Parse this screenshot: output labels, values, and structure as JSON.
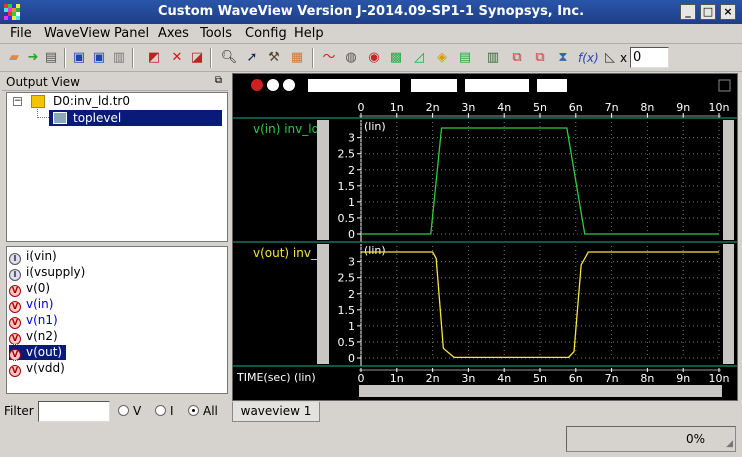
{
  "window": {
    "title": "Custom WaveView Version J-2014.09-SP1-1 Synopsys, Inc."
  },
  "menu": [
    "File",
    "WaveView",
    "Panel",
    "Axes",
    "Tools",
    "Config",
    "Help"
  ],
  "toolbar": {
    "x_label": "x",
    "x_value": "0"
  },
  "output_view": {
    "title": "Output View",
    "tree_root": "D0:inv_ld.tr0",
    "tree_child": "toplevel"
  },
  "signals": [
    {
      "label": "i(vin)",
      "kind": "current"
    },
    {
      "label": "i(vsupply)",
      "kind": "current"
    },
    {
      "label": "v(0)",
      "kind": "voltage"
    },
    {
      "label": "v(in)",
      "kind": "voltage",
      "color": "blue"
    },
    {
      "label": "v(n1)",
      "kind": "voltage",
      "color": "blue"
    },
    {
      "label": "v(n2)",
      "kind": "voltage"
    },
    {
      "label": "v(out)",
      "kind": "voltage",
      "selected": true
    },
    {
      "label": "v(vdd)",
      "kind": "voltage"
    }
  ],
  "filter": {
    "label": "Filter",
    "value": "",
    "options": [
      "V",
      "I",
      "All"
    ],
    "selected": "All"
  },
  "wave": {
    "tab": "waveview 1",
    "x_axis_label": "TIME(sec) (lin)",
    "x_ticks": [
      "0",
      "1n",
      "2n",
      "3n",
      "4n",
      "5n",
      "6n",
      "7n",
      "8n",
      "9n",
      "10n"
    ],
    "panels": [
      {
        "name": "v(in) inv_ld",
        "scale": "(lin)",
        "color": "#2ecc40",
        "y_ticks": [
          "0",
          "0.5",
          "1",
          "1.5",
          "2",
          "2.5",
          "3"
        ]
      },
      {
        "name": "v(out) inv_",
        "scale": "(lin)",
        "color": "#f5e63a",
        "y_ticks": [
          "0",
          "0.5",
          "1",
          "1.5",
          "2",
          "2.5",
          "3"
        ]
      }
    ]
  },
  "chart_data": [
    {
      "type": "line",
      "title": "",
      "series": [
        {
          "name": "v(in) inv_ld",
          "x": [
            0,
            1.95,
            2.25,
            5.75,
            6.25,
            10
          ],
          "y": [
            0,
            0,
            3.3,
            3.3,
            0,
            0
          ]
        }
      ],
      "xlabel": "TIME(sec) (lin)",
      "ylabel": "",
      "xlim": [
        0,
        10
      ],
      "ylim": [
        0,
        3.3
      ],
      "x_unit": "ns",
      "grid": true
    },
    {
      "type": "line",
      "title": "",
      "series": [
        {
          "name": "v(out) inv_",
          "x": [
            0,
            2.0,
            2.1,
            2.3,
            2.6,
            5.8,
            5.95,
            6.15,
            6.35,
            10
          ],
          "y": [
            3.3,
            3.3,
            3.1,
            0.3,
            0.02,
            0.02,
            0.2,
            2.9,
            3.3,
            3.3
          ]
        }
      ],
      "xlabel": "TIME(sec) (lin)",
      "ylabel": "",
      "xlim": [
        0,
        10
      ],
      "ylim": [
        0,
        3.3
      ],
      "x_unit": "ns",
      "grid": true
    }
  ],
  "status": {
    "progress": "0%"
  }
}
